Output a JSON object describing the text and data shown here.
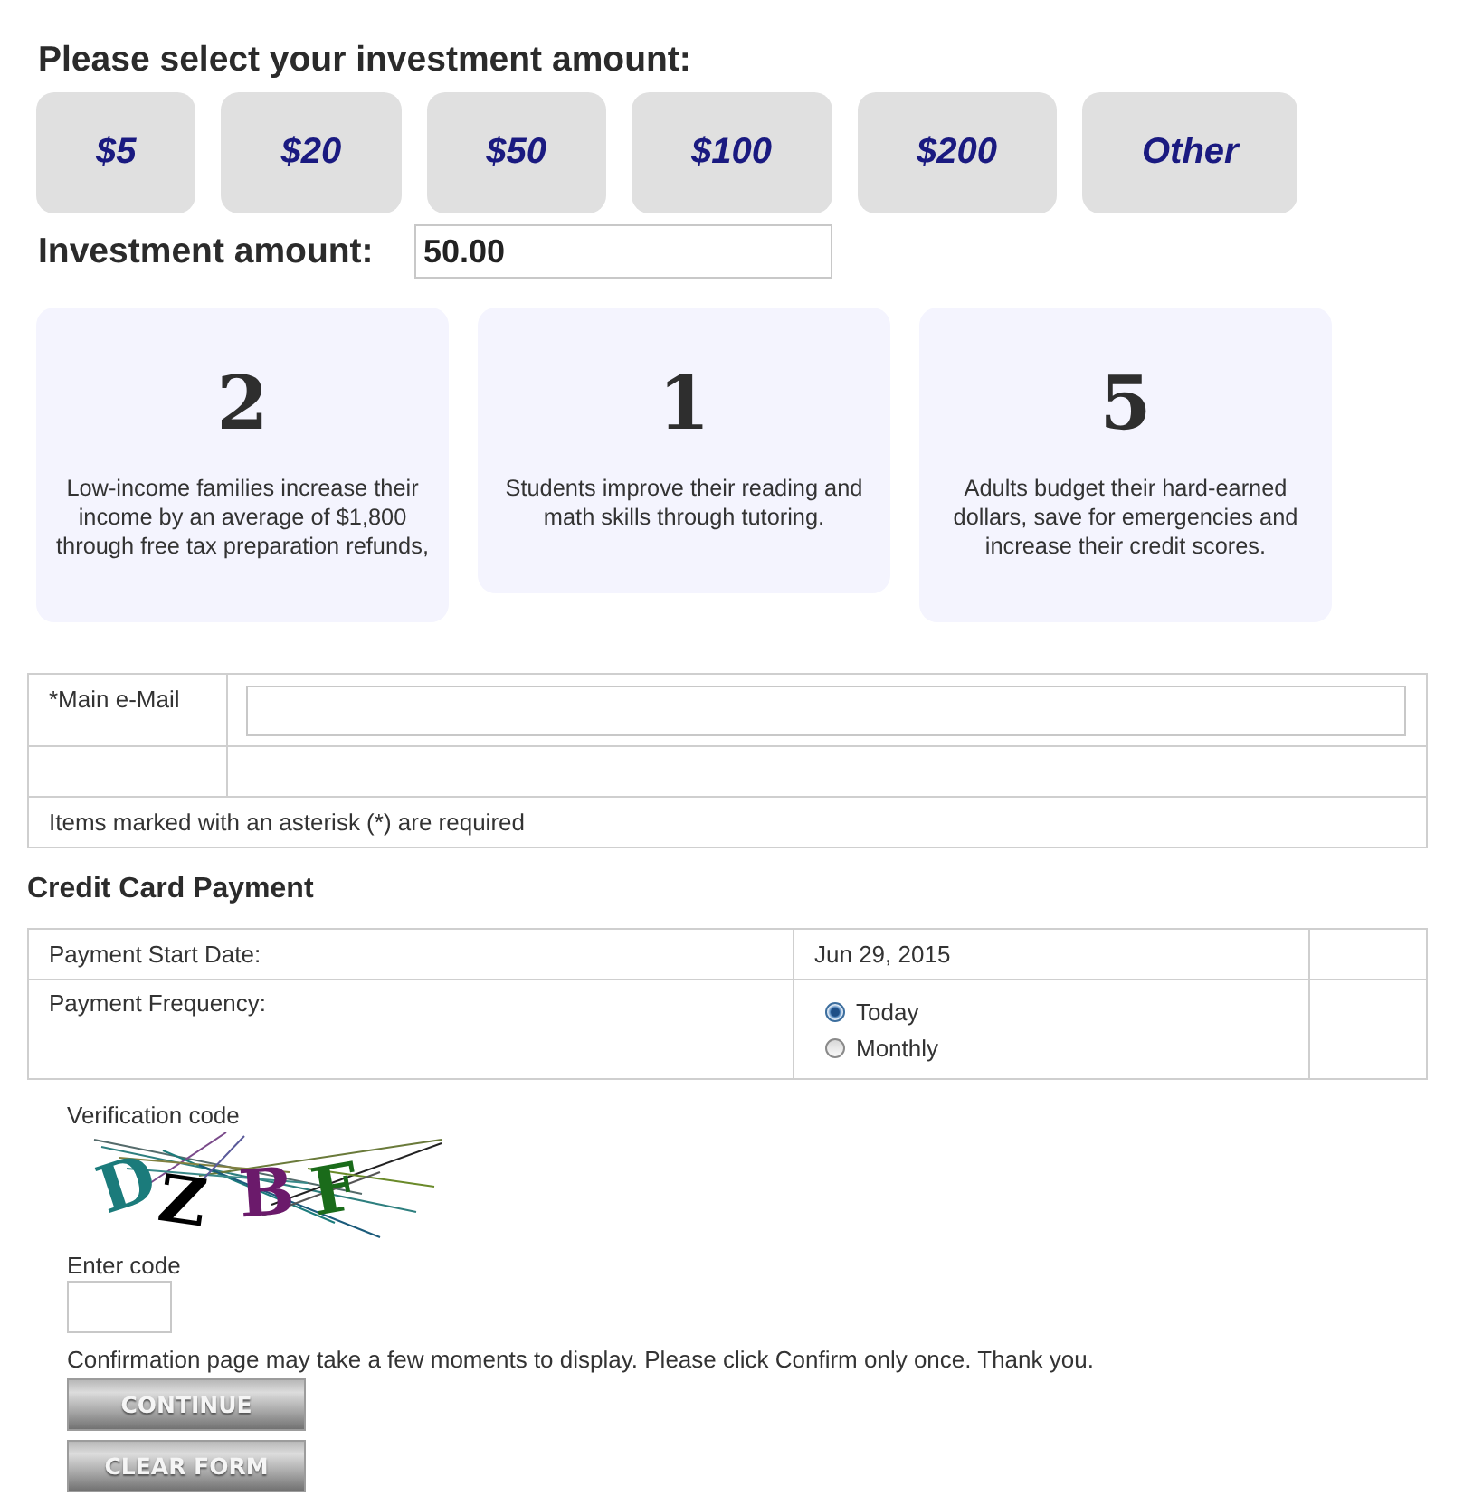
{
  "amount_selection": {
    "heading": "Please select your investment amount:",
    "options": [
      "$5",
      "$20",
      "$50",
      "$100",
      "$200",
      "Other"
    ]
  },
  "investment_amount": {
    "label": "Investment amount:",
    "value": "50.00"
  },
  "impact_cards": [
    {
      "number": "2",
      "text": "Low-income families increase their income by an average of $1,800 through free tax preparation refunds,"
    },
    {
      "number": "1",
      "text": "Students improve their reading and math skills through tutoring."
    },
    {
      "number": "5",
      "text": "Adults budget their hard-earned dollars, save for emergencies and increase their credit scores."
    }
  ],
  "contact_form": {
    "email_label": "*Main e-Mail",
    "required_note": "Items marked with an asterisk (*) are required"
  },
  "payment": {
    "title": "Credit Card Payment",
    "start_date": {
      "label": "Payment Start Date:",
      "value": "Jun 29, 2015"
    },
    "frequency": {
      "label": "Payment Frequency:",
      "options": [
        {
          "label": "Today",
          "selected": true
        },
        {
          "label": "Monthly",
          "selected": false
        }
      ]
    }
  },
  "verification": {
    "label": "Verification code",
    "captcha_letters": [
      {
        "char": "D",
        "color": "#1b7b7b"
      },
      {
        "char": "Z",
        "color": "#000000"
      },
      {
        "char": "B",
        "color": "#6b1a6b"
      },
      {
        "char": "F",
        "color": "#1a6b1a"
      }
    ],
    "input_label": "Enter code",
    "notice": "Confirmation page may take a few moments to display. Please click Confirm only once. Thank you."
  },
  "buttons": [
    "CONTINUE",
    "CLEAR FORM"
  ]
}
